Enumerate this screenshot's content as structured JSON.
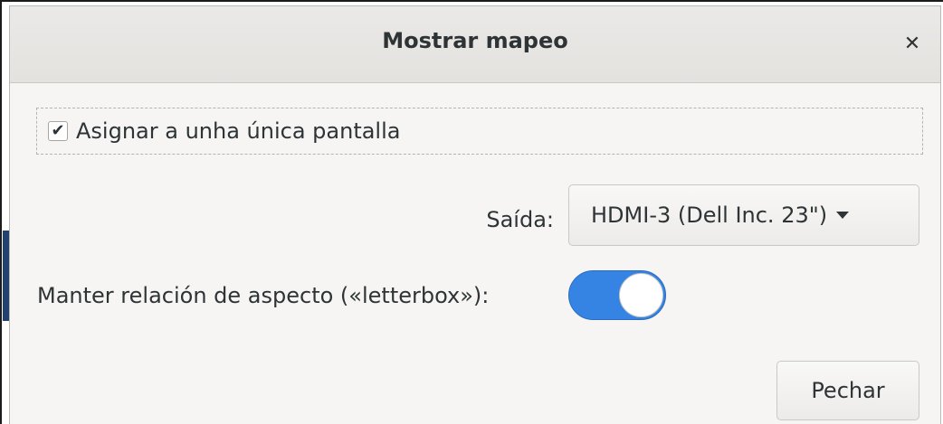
{
  "dialog": {
    "title": "Mostrar mapeo",
    "close_icon": "close-icon",
    "close_glyph": "✕"
  },
  "map_single_screen": {
    "label": "Asignar a unha única pantalla",
    "checked": true,
    "check_glyph": "✔"
  },
  "output": {
    "label": "Saída:",
    "selected": "HDMI-3 (Dell Inc. 23\")",
    "arrow_icon": "pan-down-icon"
  },
  "keep_aspect": {
    "label": "Manter relación de aspecto («letterbox»):",
    "enabled": true,
    "accent_color": "#3584e4"
  },
  "footer": {
    "close_label": "Pechar"
  }
}
